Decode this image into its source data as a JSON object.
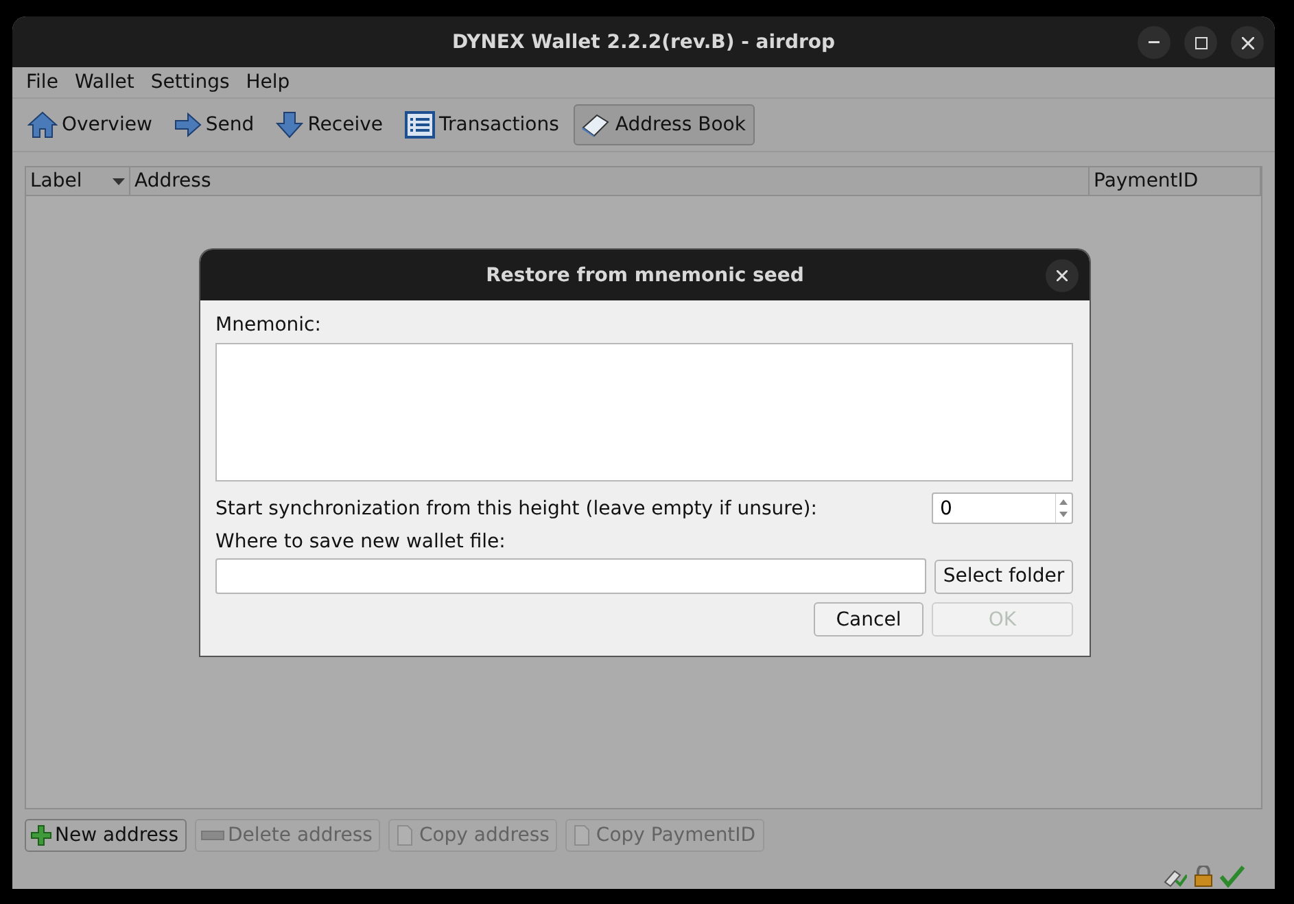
{
  "window": {
    "title": "DYNEX Wallet 2.2.2(rev.B) - airdrop"
  },
  "menu": [
    "File",
    "Wallet",
    "Settings",
    "Help"
  ],
  "toolbar": [
    {
      "label": "Overview",
      "kind": "home",
      "selected": false
    },
    {
      "label": "Send",
      "kind": "send",
      "selected": false
    },
    {
      "label": "Receive",
      "kind": "receive",
      "selected": false
    },
    {
      "label": "Transactions",
      "kind": "list",
      "selected": false
    },
    {
      "label": "Address Book",
      "kind": "book",
      "selected": true
    }
  ],
  "table": {
    "columns": [
      {
        "label": "Label",
        "sorted": true
      },
      {
        "label": "Address",
        "sorted": false
      },
      {
        "label": "PaymentID",
        "sorted": false
      }
    ]
  },
  "actions": [
    {
      "label": "New address",
      "kind": "plus",
      "disabled": false
    },
    {
      "label": "Delete address",
      "kind": "minus",
      "disabled": true
    },
    {
      "label": "Copy address",
      "kind": "copy",
      "disabled": true
    },
    {
      "label": "Copy PaymentID",
      "kind": "copy",
      "disabled": true
    }
  ],
  "dialog": {
    "title": "Restore from mnemonic seed",
    "mnemonic_label": "Mnemonic:",
    "height_label": "Start synchronization from this height (leave empty if unsure):",
    "height_value": "0",
    "file_label": "Where to save new wallet file:",
    "select_button": "Select folder",
    "cancel_button": "Cancel",
    "ok_button": {
      "label": "OK",
      "disabled": true
    }
  }
}
